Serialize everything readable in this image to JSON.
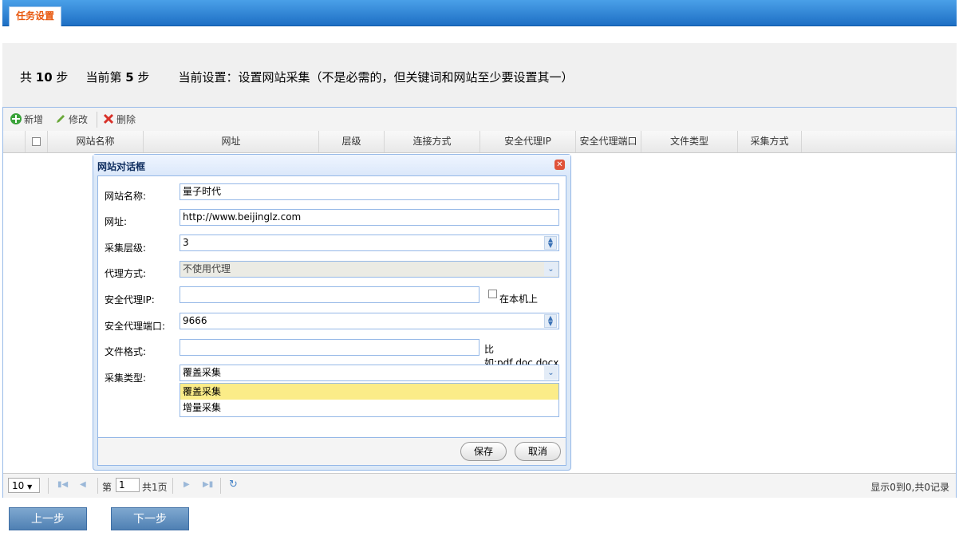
{
  "header": {
    "tab_label": "任务设置"
  },
  "info": {
    "total_prefix": "共 ",
    "total_steps": "10",
    "total_suffix": " 步",
    "current_prefix": "当前第 ",
    "current_step": "5",
    "current_suffix": " 步",
    "current_setting": "当前设置：设置网站采集（不是必需的，但关键词和网站至少要设置其一）"
  },
  "toolbar": {
    "add_label": "新增",
    "edit_label": "修改",
    "delete_label": "删除"
  },
  "grid": {
    "columns": [
      "网站名称",
      "网址",
      "层级",
      "连接方式",
      "安全代理IP",
      "安全代理端口",
      "文件类型",
      "采集方式"
    ]
  },
  "pager": {
    "page_size": "10",
    "page_prefix": "第",
    "page_value": "1",
    "page_total": "共1页",
    "record_info": "显示0到0,共0记录"
  },
  "dialog": {
    "title": "网站对话框",
    "fields": {
      "name_label": "网站名称:",
      "name_value": "量子时代",
      "url_label": "网址:",
      "url_value": "http://www.beijinglz.com",
      "level_label": "采集层级:",
      "level_value": "3",
      "proxy_mode_label": "代理方式:",
      "proxy_mode_value": "不使用代理",
      "proxy_ip_label": "安全代理IP:",
      "proxy_ip_value": "",
      "local_machine_label": "在本机上",
      "proxy_port_label": "安全代理端口:",
      "proxy_port_value": "9666",
      "file_format_label": "文件格式:",
      "file_format_value": "",
      "file_format_hint": "比如:pdf,doc,docx",
      "collect_type_label": "采集类型:",
      "collect_type_value": "覆盖采集"
    },
    "dropdown_options": [
      "覆盖采集",
      "增量采集"
    ],
    "save_label": "保存",
    "cancel_label": "取消"
  },
  "nav": {
    "prev_label": "上一步",
    "next_label": "下一步"
  }
}
